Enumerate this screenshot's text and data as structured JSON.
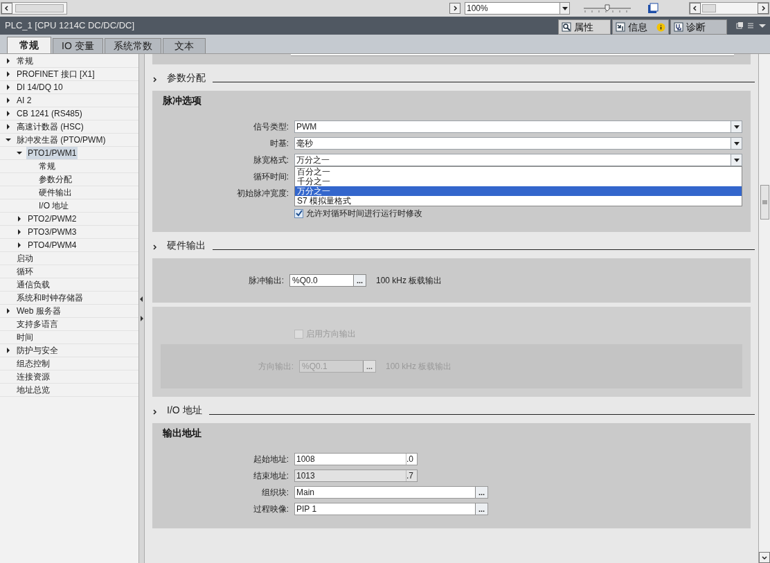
{
  "toolbar": {
    "zoom": "100%",
    "zoom_slider": {
      "level": 0.5
    }
  },
  "title_bar": {
    "title": "PLC_1 [CPU 1214C DC/DC/DC]",
    "tabs": [
      {
        "label": "属性",
        "selected": true,
        "kind": "properties"
      },
      {
        "label": "信息",
        "selected": false,
        "kind": "info"
      },
      {
        "label": "诊断",
        "selected": false,
        "kind": "diagnostics"
      }
    ]
  },
  "tabs": [
    {
      "label": "常规",
      "selected": true
    },
    {
      "label": "IO 变量",
      "selected": false
    },
    {
      "label": "系统常数",
      "selected": false
    },
    {
      "label": "文本",
      "selected": false
    }
  ],
  "tree": [
    {
      "label": "常规",
      "expanded": false,
      "selected": false
    },
    {
      "label": "PROFINET 接口 [X1]",
      "expanded": false,
      "selected": false
    },
    {
      "label": "DI 14/DQ 10",
      "expanded": false,
      "selected": false
    },
    {
      "label": "AI 2",
      "expanded": false,
      "selected": false
    },
    {
      "label": "CB 1241 (RS485)",
      "expanded": false,
      "selected": false
    },
    {
      "label": "高速计数器 (HSC)",
      "expanded": false,
      "selected": false
    },
    {
      "label": "脉冲发生器 (PTO/PWM)",
      "expanded": true,
      "selected": false,
      "children": [
        {
          "label": "PTO1/PWM1",
          "expanded": true,
          "selected": true,
          "children": [
            {
              "label": "常规",
              "selected": false
            },
            {
              "label": "参数分配",
              "selected": false
            },
            {
              "label": "硬件输出",
              "selected": false
            },
            {
              "label": "I/O 地址",
              "selected": false
            }
          ]
        },
        {
          "label": "PTO2/PWM2",
          "expanded": false,
          "selected": false
        },
        {
          "label": "PTO3/PWM3",
          "expanded": false,
          "selected": false
        },
        {
          "label": "PTO4/PWM4",
          "expanded": false,
          "selected": false
        }
      ]
    },
    {
      "label": "启动",
      "selected": false
    },
    {
      "label": "循环",
      "selected": false
    },
    {
      "label": "通信负载",
      "selected": false
    },
    {
      "label": "系统和时钟存储器",
      "selected": false
    },
    {
      "label": "Web 服务器",
      "expanded": false,
      "selected": false
    },
    {
      "label": "支持多语言",
      "selected": false
    },
    {
      "label": "时间",
      "selected": false
    },
    {
      "label": "防护与安全",
      "expanded": false,
      "selected": false
    },
    {
      "label": "组态控制",
      "selected": false
    },
    {
      "label": "连接资源",
      "selected": false
    },
    {
      "label": "地址总览",
      "selected": false
    }
  ],
  "sections": [
    {
      "title": "参数分配",
      "panels": [
        {
          "title": "脉冲选项",
          "disabled": false,
          "rows": [
            {
              "kind": "dropdown",
              "label": "信号类型:",
              "value": "PWM"
            },
            {
              "kind": "dropdown",
              "label": "时基:",
              "value": "毫秒"
            },
            {
              "kind": "dropdown",
              "label": "脉宽格式:",
              "value": "万分之一",
              "options": [
                {
                  "label": "百分之一",
                  "selected": false
                },
                {
                  "label": "千分之一",
                  "selected": false
                },
                {
                  "label": "万分之一",
                  "selected": true
                },
                {
                  "label": "S7 模拟量格式",
                  "selected": false
                }
              ]
            },
            {
              "kind": "label",
              "label": "循环时间:"
            },
            {
              "kind": "label",
              "label": "初始脉冲宽度:"
            },
            {
              "kind": "checkbox",
              "label": "允许对循环时间进行运行时修改",
              "checked": true
            }
          ]
        }
      ]
    },
    {
      "title": "硬件输出",
      "panels": [
        {
          "disabled": false,
          "rows": [
            {
              "kind": "browse_short",
              "label": "脉冲输出:",
              "value": "%Q0.0",
              "button": "...",
              "note": "100 kHz 板载输出"
            }
          ]
        },
        {
          "disabled": true,
          "rows": [
            {
              "kind": "checkbox",
              "label": "启用方向输出",
              "checked": false
            },
            {
              "kind": "inset",
              "rows": [
                {
                  "kind": "browse_short",
                  "label": "方向输出:",
                  "value": "%Q0.1",
                  "button": "...",
                  "note": "100 kHz 板载输出"
                }
              ]
            }
          ]
        }
      ]
    },
    {
      "title": "I/O 地址",
      "panels": [
        {
          "title": "输出地址",
          "disabled": false,
          "rows": [
            {
              "kind": "address",
              "label": "起始地址:",
              "value": "1008",
              "bit": ".0",
              "readonly": false
            },
            {
              "kind": "address",
              "label": "结束地址:",
              "value": "1013",
              "bit": ".7",
              "readonly": true
            },
            {
              "kind": "browse",
              "label": "组织块:",
              "value": "Main",
              "button": "..."
            },
            {
              "kind": "browse",
              "label": "过程映像:",
              "value": "PIP 1",
              "button": "..."
            }
          ]
        }
      ]
    }
  ]
}
